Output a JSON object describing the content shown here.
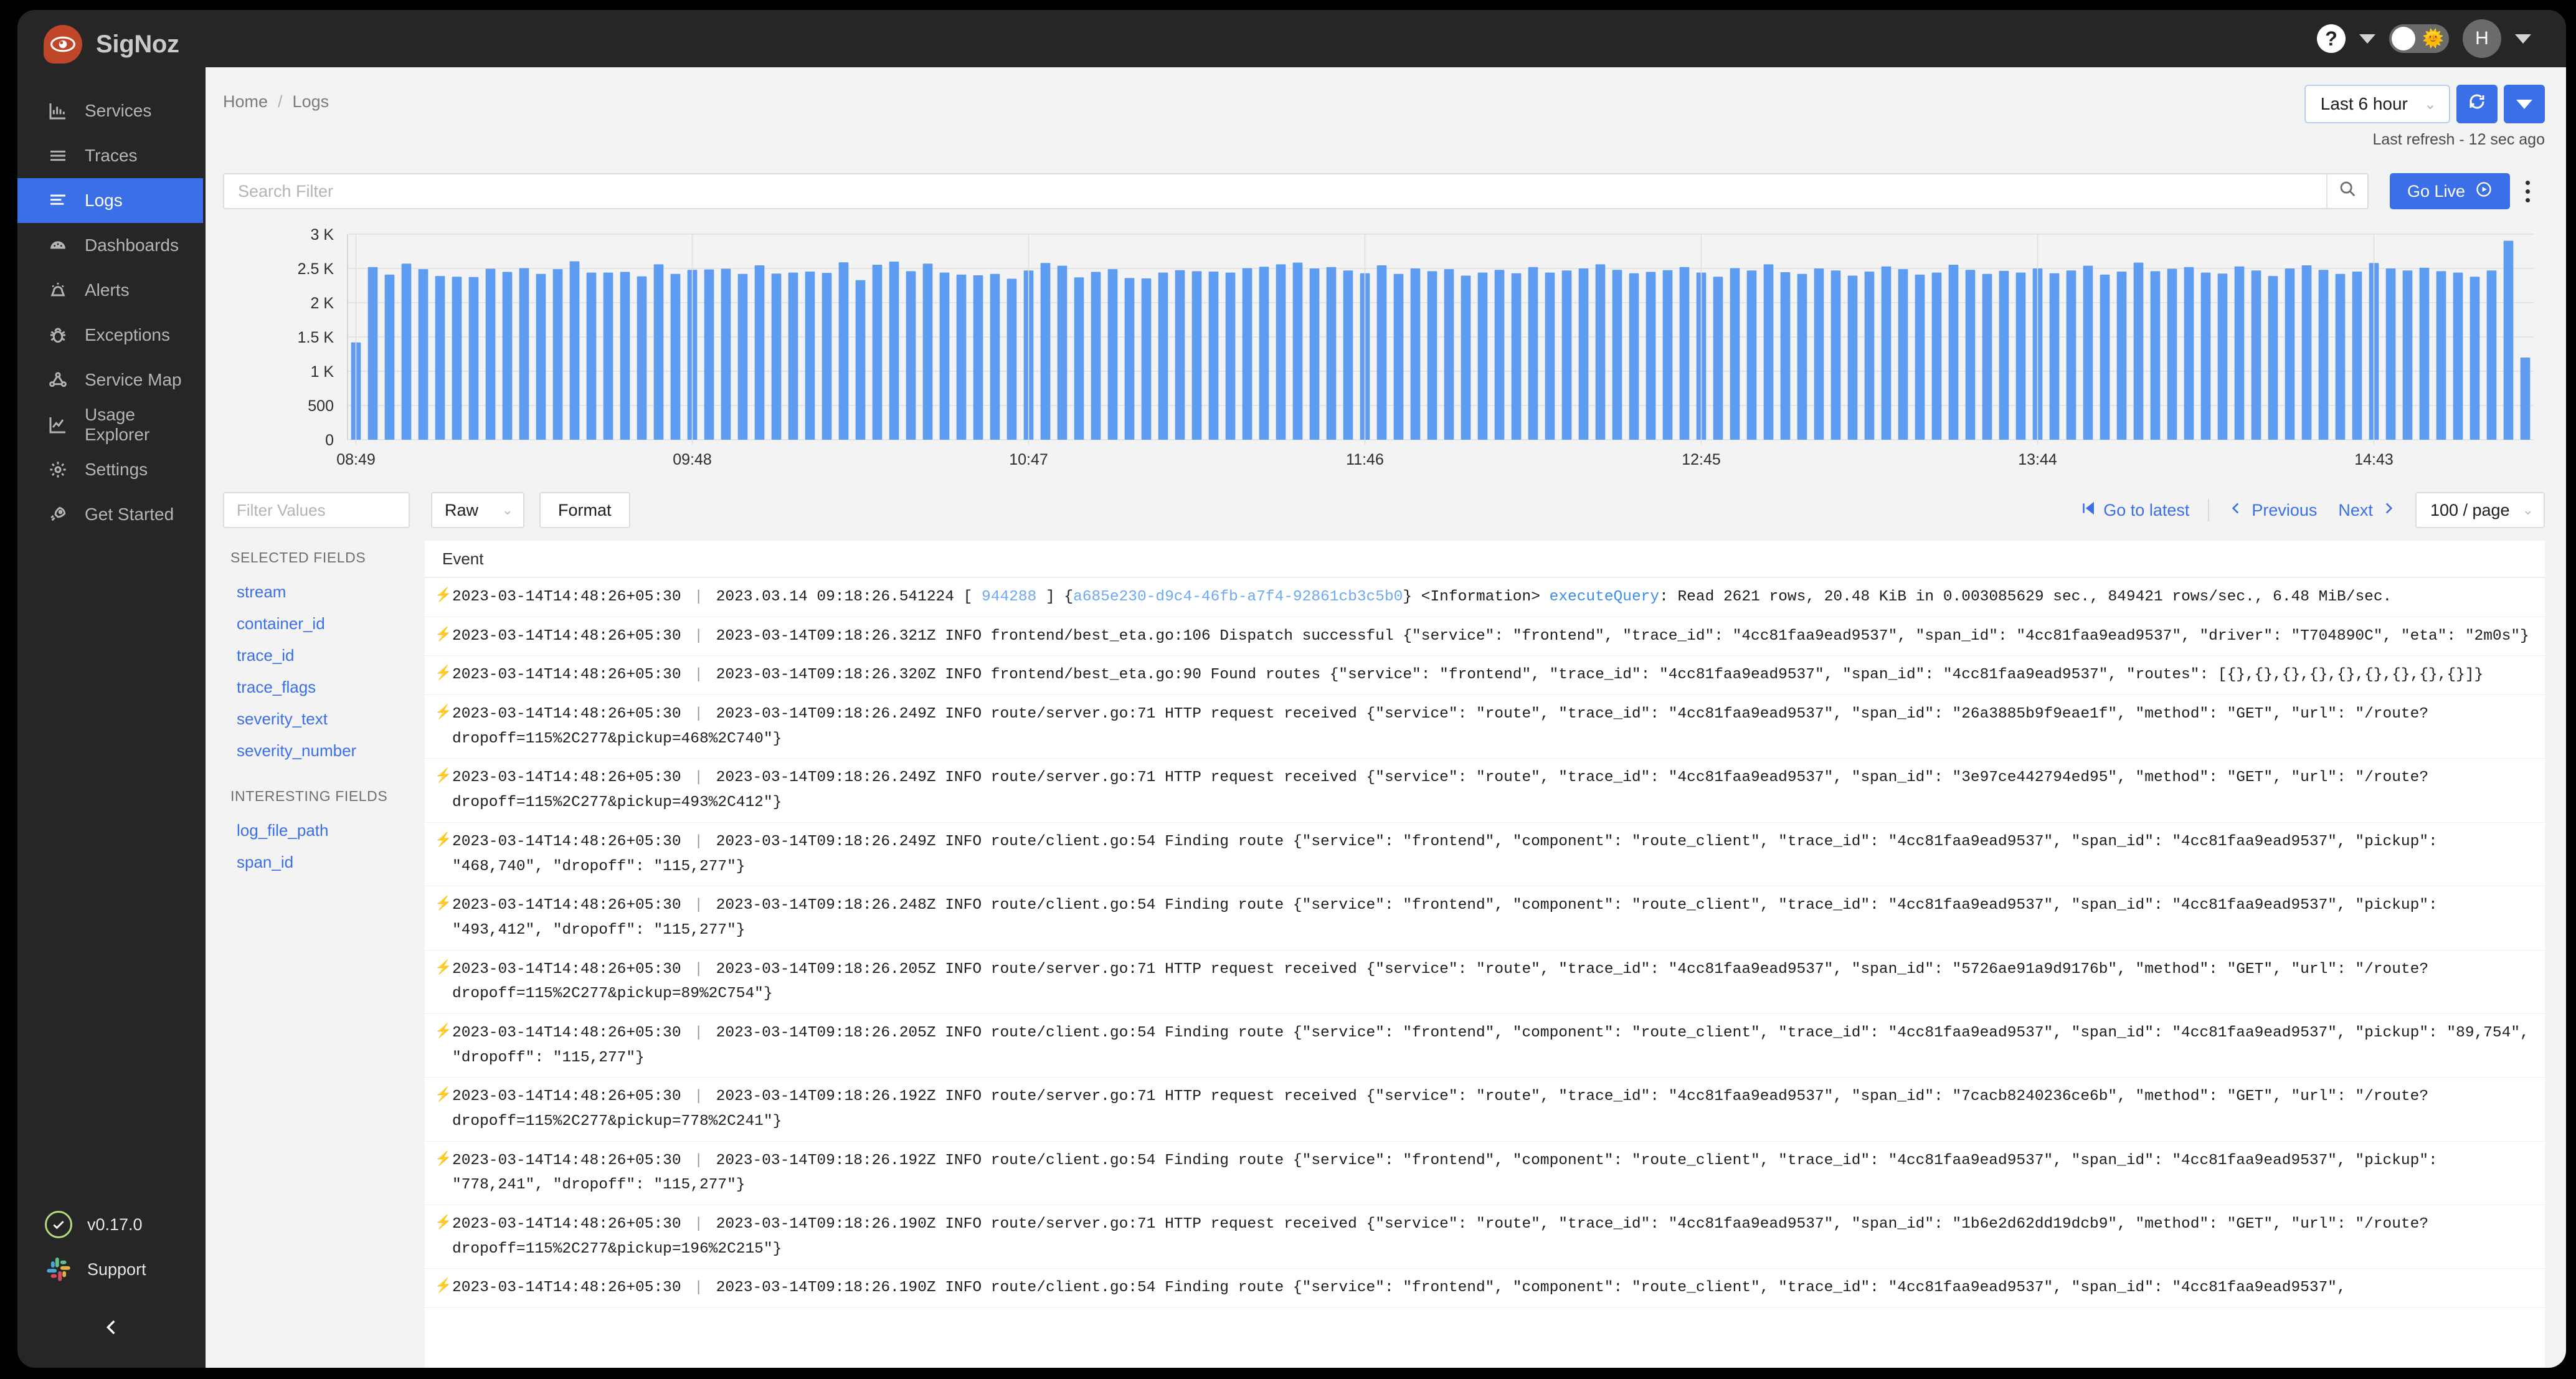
{
  "brand": {
    "name": "SigNoz",
    "logo_icon": "eye-icon"
  },
  "sidebar": {
    "items": [
      {
        "label": "Services",
        "icon": "bar-chart-icon",
        "active": false
      },
      {
        "label": "Traces",
        "icon": "list-lines-icon",
        "active": false
      },
      {
        "label": "Logs",
        "icon": "logs-lines-icon",
        "active": true
      },
      {
        "label": "Dashboards",
        "icon": "gauge-icon",
        "active": false
      },
      {
        "label": "Alerts",
        "icon": "alert-bell-icon",
        "active": false
      },
      {
        "label": "Exceptions",
        "icon": "bug-icon",
        "active": false
      },
      {
        "label": "Service Map",
        "icon": "node-graph-icon",
        "active": false
      },
      {
        "label": "Usage Explorer",
        "icon": "line-chart-icon",
        "active": false
      },
      {
        "label": "Settings",
        "icon": "gear-icon",
        "active": false
      },
      {
        "label": "Get Started",
        "icon": "rocket-icon",
        "active": false
      }
    ],
    "version": "v0.17.0",
    "support": "Support",
    "collapse_icon": "chevron-left-icon"
  },
  "topbar": {
    "help_icon": "question-mark-icon",
    "theme_toggle_icon": "sun-icon",
    "avatar_initial": "H"
  },
  "breadcrumb": {
    "home": "Home",
    "separator": "/",
    "current": "Logs"
  },
  "timerange": {
    "selected": "Last 6 hour",
    "refresh_icon": "refresh-icon",
    "dropdown_icon": "caret-down-icon",
    "last_refresh": "Last refresh - 12 sec ago"
  },
  "search": {
    "placeholder": "Search Filter",
    "value": "",
    "search_icon": "search-icon",
    "go_live_label": "Go Live",
    "go_live_icon": "play-circle-icon",
    "more_icon": "kebab-menu-icon"
  },
  "toolbar": {
    "filter_values_placeholder": "Filter Values",
    "filter_values_value": "",
    "view_mode": "Raw",
    "format_label": "Format",
    "go_to_latest": "Go to latest",
    "go_to_latest_icon": "skip-back-icon",
    "previous": "Previous",
    "next": "Next",
    "page_size": "100 / page"
  },
  "fields": {
    "selected_title": "SELECTED FIELDS",
    "selected": [
      "stream",
      "container_id",
      "trace_id",
      "trace_flags",
      "severity_text",
      "severity_number"
    ],
    "interesting_title": "INTERESTING FIELDS",
    "interesting": [
      "log_file_path",
      "span_id"
    ]
  },
  "logs_table": {
    "column_header": "Event",
    "rows": [
      {
        "timestamp": "2023-03-14T14:48:26+05:30",
        "body_pre": "2023.03.14 09:18:26.541224 [ ",
        "hl1": "944288",
        "body_mid": " ] {",
        "hl2": "a685e230-d9c4-46fb-a7f4-92861cb3c5b0",
        "body_mid2": "} <Information> ",
        "hl3": "executeQuery",
        "body_post": ": Read 2621 rows, 20.48 KiB in 0.003085629 sec., 849421 rows/sec., 6.48 MiB/sec."
      },
      {
        "timestamp": "2023-03-14T14:48:26+05:30",
        "body": "2023-03-14T09:18:26.321Z INFO frontend/best_eta.go:106 Dispatch successful {\"service\": \"frontend\", \"trace_id\": \"4cc81faa9ead9537\", \"span_id\": \"4cc81faa9ead9537\", \"driver\": \"T704890C\", \"eta\": \"2m0s\"}"
      },
      {
        "timestamp": "2023-03-14T14:48:26+05:30",
        "body": "2023-03-14T09:18:26.320Z INFO frontend/best_eta.go:90 Found routes {\"service\": \"frontend\", \"trace_id\": \"4cc81faa9ead9537\", \"span_id\": \"4cc81faa9ead9537\", \"routes\": [{},{},{},{},{},{},{},{},{}]}"
      },
      {
        "timestamp": "2023-03-14T14:48:26+05:30",
        "body": "2023-03-14T09:18:26.249Z INFO route/server.go:71 HTTP request received {\"service\": \"route\", \"trace_id\": \"4cc81faa9ead9537\", \"span_id\": \"26a3885b9f9eae1f\", \"method\": \"GET\", \"url\": \"/route?dropoff=115%2C277&pickup=468%2C740\"}"
      },
      {
        "timestamp": "2023-03-14T14:48:26+05:30",
        "body": "2023-03-14T09:18:26.249Z INFO route/server.go:71 HTTP request received {\"service\": \"route\", \"trace_id\": \"4cc81faa9ead9537\", \"span_id\": \"3e97ce442794ed95\", \"method\": \"GET\", \"url\": \"/route?dropoff=115%2C277&pickup=493%2C412\"}"
      },
      {
        "timestamp": "2023-03-14T14:48:26+05:30",
        "body": "2023-03-14T09:18:26.249Z INFO route/client.go:54 Finding route {\"service\": \"frontend\", \"component\": \"route_client\", \"trace_id\": \"4cc81faa9ead9537\", \"span_id\": \"4cc81faa9ead9537\", \"pickup\": \"468,740\", \"dropoff\": \"115,277\"}"
      },
      {
        "timestamp": "2023-03-14T14:48:26+05:30",
        "body": "2023-03-14T09:18:26.248Z INFO route/client.go:54 Finding route {\"service\": \"frontend\", \"component\": \"route_client\", \"trace_id\": \"4cc81faa9ead9537\", \"span_id\": \"4cc81faa9ead9537\", \"pickup\": \"493,412\", \"dropoff\": \"115,277\"}"
      },
      {
        "timestamp": "2023-03-14T14:48:26+05:30",
        "body": "2023-03-14T09:18:26.205Z INFO route/server.go:71 HTTP request received {\"service\": \"route\", \"trace_id\": \"4cc81faa9ead9537\", \"span_id\": \"5726ae91a9d9176b\", \"method\": \"GET\", \"url\": \"/route?dropoff=115%2C277&pickup=89%2C754\"}"
      },
      {
        "timestamp": "2023-03-14T14:48:26+05:30",
        "body": "2023-03-14T09:18:26.205Z INFO route/client.go:54 Finding route {\"service\": \"frontend\", \"component\": \"route_client\", \"trace_id\": \"4cc81faa9ead9537\", \"span_id\": \"4cc81faa9ead9537\", \"pickup\": \"89,754\", \"dropoff\": \"115,277\"}"
      },
      {
        "timestamp": "2023-03-14T14:48:26+05:30",
        "body": "2023-03-14T09:18:26.192Z INFO route/server.go:71 HTTP request received {\"service\": \"route\", \"trace_id\": \"4cc81faa9ead9537\", \"span_id\": \"7cacb8240236ce6b\", \"method\": \"GET\", \"url\": \"/route?dropoff=115%2C277&pickup=778%2C241\"}"
      },
      {
        "timestamp": "2023-03-14T14:48:26+05:30",
        "body": "2023-03-14T09:18:26.192Z INFO route/client.go:54 Finding route {\"service\": \"frontend\", \"component\": \"route_client\", \"trace_id\": \"4cc81faa9ead9537\", \"span_id\": \"4cc81faa9ead9537\", \"pickup\": \"778,241\", \"dropoff\": \"115,277\"}"
      },
      {
        "timestamp": "2023-03-14T14:48:26+05:30",
        "body": "2023-03-14T09:18:26.190Z INFO route/server.go:71 HTTP request received {\"service\": \"route\", \"trace_id\": \"4cc81faa9ead9537\", \"span_id\": \"1b6e2d62dd19dcb9\", \"method\": \"GET\", \"url\": \"/route?dropoff=115%2C277&pickup=196%2C215\"}"
      },
      {
        "timestamp": "2023-03-14T14:48:26+05:30",
        "body": "2023-03-14T09:18:26.190Z INFO route/client.go:54 Finding route {\"service\": \"frontend\", \"component\": \"route_client\", \"trace_id\": \"4cc81faa9ead9537\", \"span_id\": \"4cc81faa9ead9537\","
      }
    ]
  },
  "chart_data": {
    "type": "bar",
    "title": "",
    "xlabel": "",
    "ylabel": "",
    "ylim": [
      0,
      3000
    ],
    "yticks": [
      0,
      500,
      1000,
      1500,
      2000,
      2500,
      3000
    ],
    "ytick_labels": [
      "0",
      "500",
      "1 K",
      "1.5 K",
      "2 K",
      "2.5 K",
      "3 K"
    ],
    "xtick_labels": [
      "08:49",
      "09:48",
      "10:47",
      "11:46",
      "12:45",
      "13:44",
      "14:43"
    ],
    "xtick_positions": [
      0,
      20,
      40,
      60,
      80,
      100,
      120
    ],
    "grid": true,
    "bar_color": "#5d9cf0",
    "values": [
      1420,
      2520,
      2410,
      2570,
      2490,
      2390,
      2380,
      2375,
      2495,
      2450,
      2505,
      2420,
      2490,
      2605,
      2440,
      2440,
      2450,
      2385,
      2560,
      2420,
      2480,
      2485,
      2495,
      2420,
      2545,
      2425,
      2440,
      2455,
      2435,
      2590,
      2330,
      2555,
      2600,
      2460,
      2570,
      2440,
      2410,
      2400,
      2420,
      2350,
      2470,
      2580,
      2540,
      2370,
      2450,
      2490,
      2360,
      2355,
      2440,
      2475,
      2460,
      2455,
      2440,
      2505,
      2525,
      2560,
      2585,
      2500,
      2520,
      2470,
      2430,
      2545,
      2420,
      2500,
      2460,
      2490,
      2395,
      2440,
      2480,
      2430,
      2520,
      2440,
      2470,
      2500,
      2560,
      2480,
      2430,
      2450,
      2475,
      2520,
      2440,
      2380,
      2505,
      2470,
      2560,
      2445,
      2420,
      2500,
      2470,
      2395,
      2455,
      2530,
      2490,
      2410,
      2440,
      2555,
      2480,
      2420,
      2465,
      2440,
      2500,
      2430,
      2470,
      2540,
      2410,
      2455,
      2585,
      2460,
      2495,
      2520,
      2440,
      2425,
      2530,
      2470,
      2390,
      2500,
      2545,
      2480,
      2420,
      2455,
      2580,
      2500,
      2470,
      2510,
      2460,
      2440,
      2380,
      2470,
      2905,
      1200
    ]
  }
}
